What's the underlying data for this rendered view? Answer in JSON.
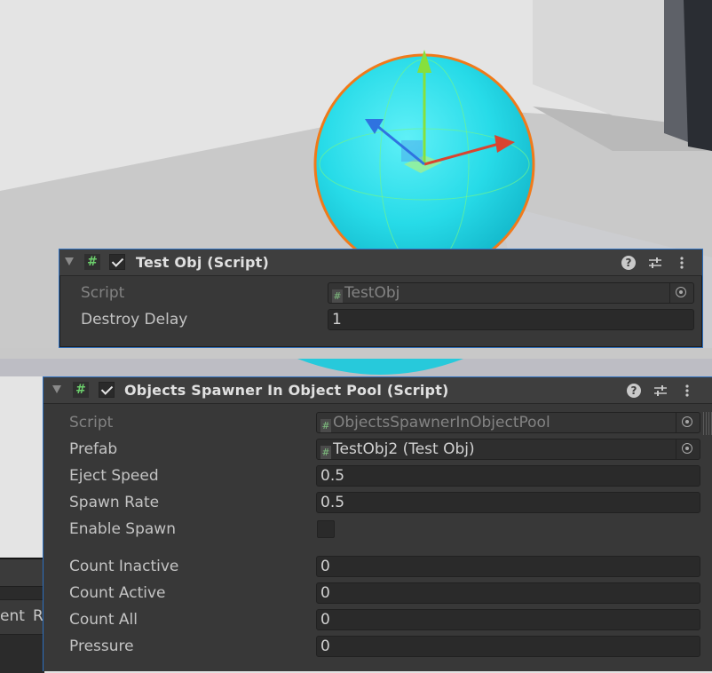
{
  "inspector": {
    "test_obj": {
      "title": "Test Obj (Script)",
      "fields": [
        {
          "label": "Script",
          "value": "TestObj",
          "kind": "object-readonly"
        },
        {
          "label": "Destroy Delay",
          "value": "1",
          "kind": "number"
        }
      ]
    },
    "spawner": {
      "title": "Objects Spawner In Object Pool (Script)",
      "script": {
        "label": "Script",
        "value": "ObjectsSpawnerInObjectPool"
      },
      "prefab": {
        "label": "Prefab",
        "value": "TestObj2 (Test Obj)"
      },
      "eject_speed": {
        "label": "Eject Speed",
        "value": "0.5"
      },
      "spawn_rate": {
        "label": "Spawn Rate",
        "value": "0.5"
      },
      "enable_spawn": {
        "label": "Enable Spawn",
        "checked": false
      },
      "count_inactive": {
        "label": "Count Inactive",
        "value": "0"
      },
      "count_active": {
        "label": "Count Active",
        "value": "0"
      },
      "count_all": {
        "label": "Count All",
        "value": "0"
      },
      "pressure": {
        "label": "Pressure",
        "value": "0"
      }
    },
    "header_icons": [
      "help-icon",
      "presets-icon",
      "more-icon"
    ]
  },
  "background_editor": {
    "tab_1": "ent",
    "tab_2": "R"
  },
  "scene": {
    "selected_object": "sphere",
    "sphere_color": "#27dbe8",
    "outline_color": "#f07a1a",
    "gizmo_colors": {
      "y": "#86e03c",
      "x": "#d9442f",
      "z": "#2f73e0"
    }
  }
}
